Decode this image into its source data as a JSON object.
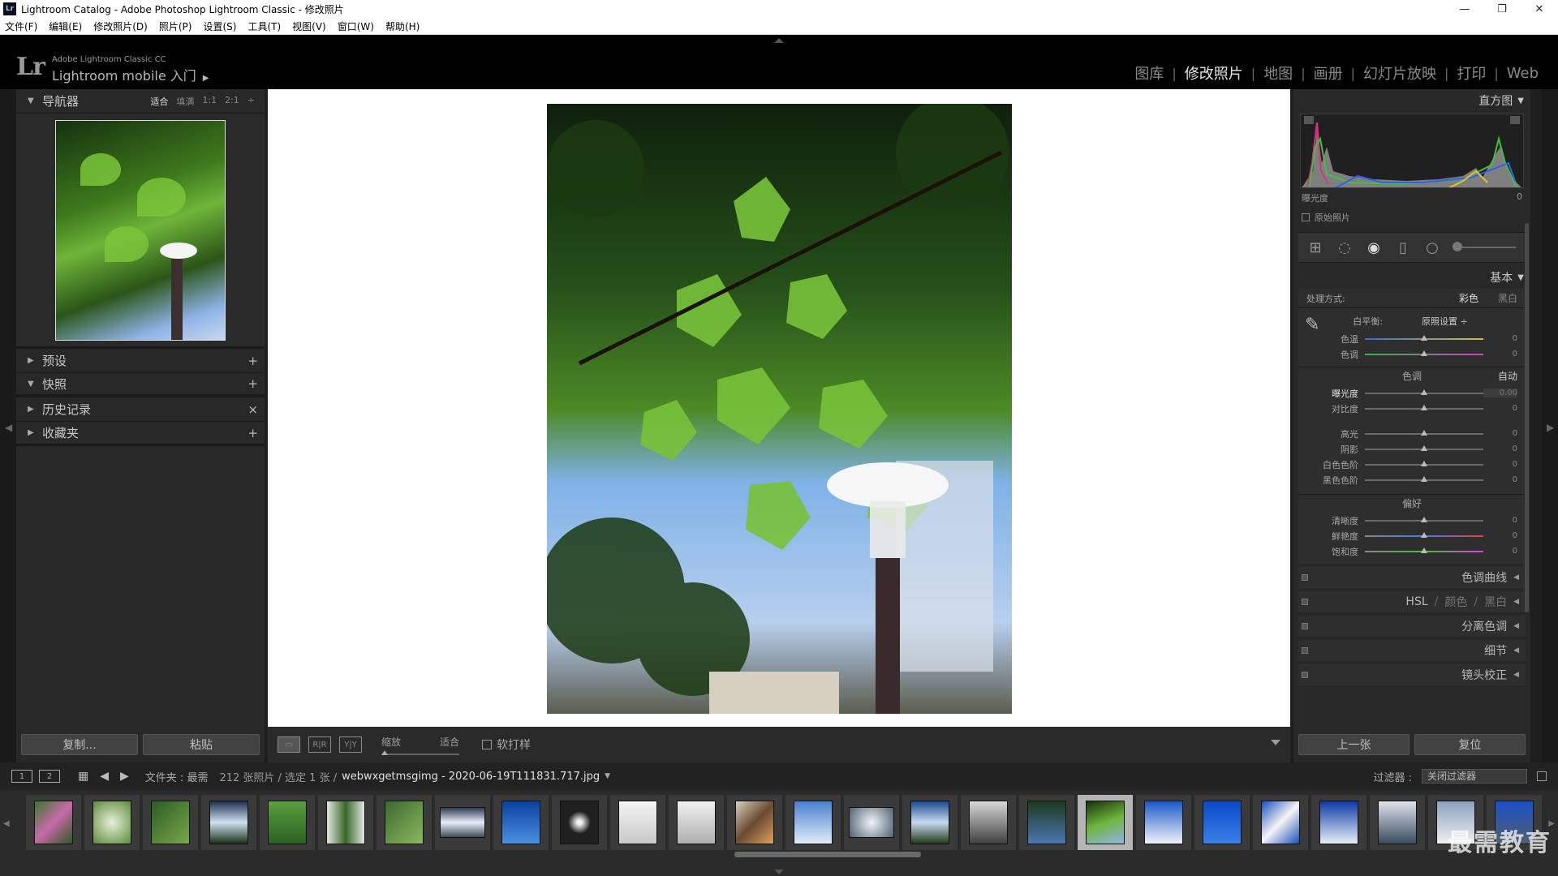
{
  "window": {
    "title": "Lightroom Catalog - Adobe Photoshop Lightroom Classic - 修改照片",
    "badge": "Lr",
    "controls": [
      "—",
      "❐",
      "✕"
    ]
  },
  "menu": [
    "文件(F)",
    "编辑(E)",
    "修改照片(D)",
    "照片(P)",
    "设置(S)",
    "工具(T)",
    "视图(V)",
    "窗口(W)",
    "帮助(H)"
  ],
  "identity": {
    "logo": "Lr",
    "sub": "Adobe Lightroom Classic CC",
    "main": "Lightroom mobile 入门",
    "arrow": "▶"
  },
  "modules": [
    {
      "label": "图库",
      "active": false
    },
    {
      "label": "修改照片",
      "active": true
    },
    {
      "label": "地图",
      "active": false
    },
    {
      "label": "画册",
      "active": false
    },
    {
      "label": "幻灯片放映",
      "active": false
    },
    {
      "label": "打印",
      "active": false
    },
    {
      "label": "Web",
      "active": false
    }
  ],
  "left": {
    "navigator": {
      "title": "导航器",
      "zoom": [
        "适合",
        "填满",
        "1:1",
        "2:1"
      ],
      "selected": "适合",
      "dd": "÷"
    },
    "panels": [
      {
        "title": "预设",
        "action": "+"
      },
      {
        "title": "快照",
        "action": "+"
      },
      {
        "title": "历史记录",
        "action": "×"
      },
      {
        "title": "收藏夹",
        "action": "+"
      }
    ],
    "copy": "复制...",
    "paste": "粘贴"
  },
  "toolbar": {
    "view_a": "▭",
    "view_b": "R|R",
    "view_c": "Y|Y",
    "zoom_label": "缩放",
    "zoom_value": "适合",
    "softproof": "软打样"
  },
  "right": {
    "histogram_title": "直方图",
    "exposure_label": "曝光度",
    "exposure_value": "0",
    "original": "原始照片",
    "basic_title": "基本",
    "treatment_label": "处理方式:",
    "treatment_color": "彩色",
    "treatment_bw": "黑白",
    "wb_label": "白平衡:",
    "wb_value": "原照设置 ÷",
    "wb_sliders": [
      {
        "label": "色温",
        "value": "0"
      },
      {
        "label": "色调",
        "value": "0"
      }
    ],
    "tone_title": "色调",
    "tone_auto": "自动",
    "tone_sliders": [
      {
        "label": "曝光度",
        "value": "0.00"
      },
      {
        "label": "对比度",
        "value": "0"
      }
    ],
    "tone_sliders2": [
      {
        "label": "高光",
        "value": "0"
      },
      {
        "label": "阴影",
        "value": "0"
      },
      {
        "label": "白色色阶",
        "value": "0"
      },
      {
        "label": "黑色色阶",
        "value": "0"
      }
    ],
    "presence_title": "偏好",
    "presence_sliders": [
      {
        "label": "清晰度",
        "value": "0"
      },
      {
        "label": "鲜艳度",
        "value": "0"
      },
      {
        "label": "饱和度",
        "value": "0"
      }
    ],
    "panels": {
      "tone_curve": "色调曲线",
      "hsl": "HSL",
      "hsl_sep": "/",
      "color": "颜色",
      "bw": "黑白",
      "split": "分离色调",
      "detail": "细节",
      "lens": "镜头校正"
    },
    "prev": "上一张",
    "reset": "复位"
  },
  "filmbar": {
    "page1": "1",
    "page2": "2",
    "folder": "文件夹 : 最需",
    "count": "212 张照片 / 选定 1 张 /",
    "filename": "webwxgetmsgimg - 2020-06-19T111831.717.jpg",
    "filter_label": "过滤器 :",
    "filter_value": "关闭过滤器"
  },
  "watermark": "最需教育",
  "colors": {
    "accent": "#e6e6e6",
    "panel": "#282828",
    "bg": "#1e1e1e"
  }
}
